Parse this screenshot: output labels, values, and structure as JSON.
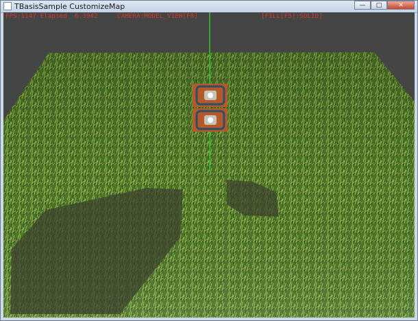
{
  "window": {
    "title": "TBasisSample CustomizeMap",
    "controls": {
      "minimize": "—",
      "maximize": "□",
      "close": "✕"
    }
  },
  "hud": {
    "fps": "FPS:1147 Elapsed  6.3942",
    "camera": "CAMERA:MODEL_VIEW[F8]",
    "fill": "[FILL[F5]:SOLID]",
    "color": "#d23c32"
  },
  "scene": {
    "background_color": "#454545",
    "terrain_color": "#4f7a2a",
    "axis_color": "#2ecc2e",
    "objects": [
      "terrain-mesh",
      "grass-texture",
      "y-axis-line",
      "character-sprite-upper",
      "character-sprite-lower",
      "shadow-left",
      "shadow-right"
    ]
  }
}
